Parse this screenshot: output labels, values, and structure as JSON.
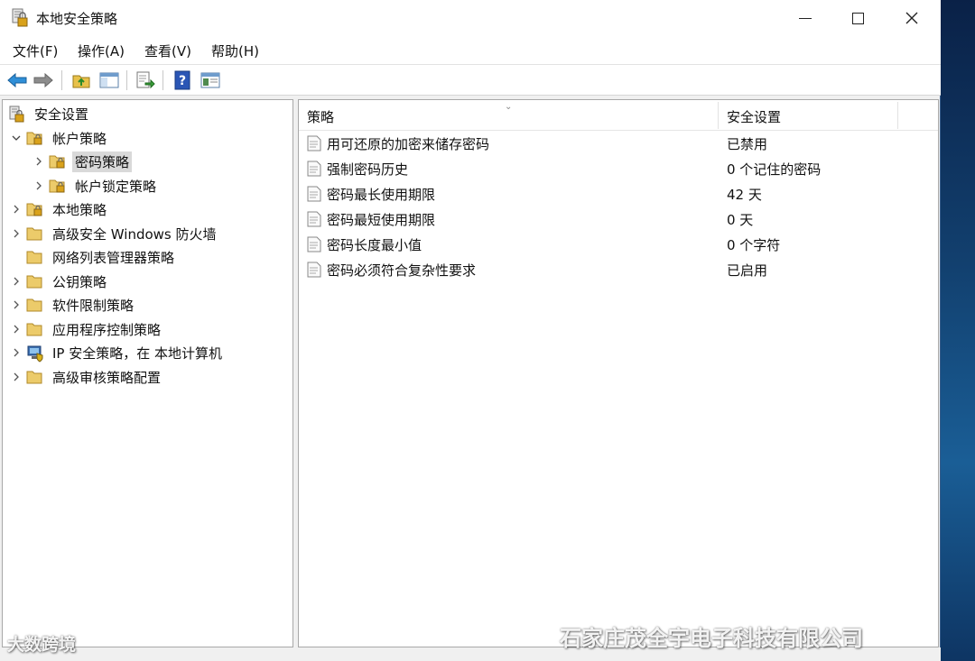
{
  "window": {
    "title": "本地安全策略"
  },
  "menu": [
    "文件(F)",
    "操作(A)",
    "查看(V)",
    "帮助(H)"
  ],
  "toolbar": {
    "buttons": [
      "back-icon",
      "forward-icon",
      "up-folder-icon",
      "show-hide-tree-icon",
      "export-list-icon",
      "help-icon",
      "properties-icon"
    ]
  },
  "tree": {
    "root": "安全设置",
    "items": [
      {
        "label": "帐户策略",
        "expanded": true
      },
      {
        "label": "密码策略",
        "selected": true
      },
      {
        "label": "帐户锁定策略"
      },
      {
        "label": "本地策略"
      },
      {
        "label": "高级安全 Windows 防火墙"
      },
      {
        "label": "网络列表管理器策略"
      },
      {
        "label": "公钥策略"
      },
      {
        "label": "软件限制策略"
      },
      {
        "label": "应用程序控制策略"
      },
      {
        "label": "IP 安全策略，在 本地计算机"
      },
      {
        "label": "高级审核策略配置"
      }
    ]
  },
  "list": {
    "columns": [
      "策略",
      "安全设置"
    ],
    "rows": [
      {
        "policy": "用可还原的加密来储存密码",
        "setting": "已禁用"
      },
      {
        "policy": "强制密码历史",
        "setting": "0 个记住的密码"
      },
      {
        "policy": "密码最长使用期限",
        "setting": "42 天"
      },
      {
        "policy": "密码最短使用期限",
        "setting": "0 天"
      },
      {
        "policy": "密码长度最小值",
        "setting": "0 个字符"
      },
      {
        "policy": "密码必须符合复杂性要求",
        "setting": "已启用"
      }
    ]
  },
  "watermarks": {
    "left": "大数跨境",
    "right": "石家庄茂全宇电子科技有限公司"
  }
}
